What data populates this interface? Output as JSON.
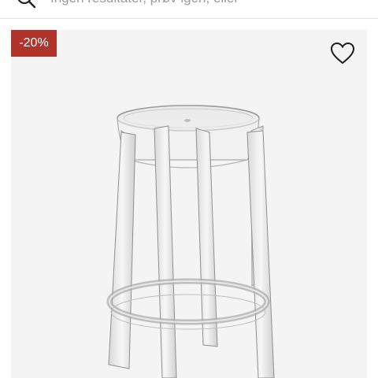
{
  "search": {
    "placeholder_visible": "Ingen resultater, prøv igen, eller",
    "icon": "search-icon"
  },
  "product": {
    "discount_badge": "-20%",
    "wishlist_icon": "heart-outline-icon",
    "image_description": "transparent-bar-stool",
    "colors": {
      "badge_bg": "#b0332c",
      "card_bg": "#f4f4f4"
    }
  }
}
